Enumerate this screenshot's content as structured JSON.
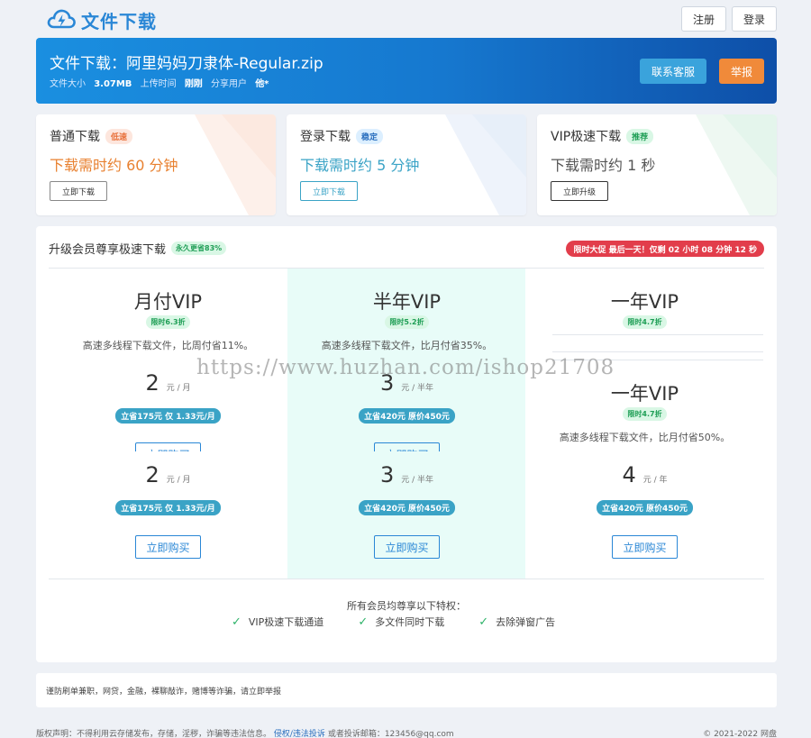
{
  "header": {
    "logo_text": "文件下载",
    "register": "注册",
    "login": "登录"
  },
  "banner": {
    "title": "文件下载：阿里妈妈刀隶体-Regular.zip",
    "size_label": "文件大小",
    "size_value": "3.07MB",
    "upload_label": "上传时间",
    "upload_value": "刚刚",
    "share_label": "分享用户",
    "share_value": "他*",
    "contact": "联系客服",
    "report": "举报"
  },
  "download_cards": [
    {
      "name": "普通下载",
      "tag": "低速",
      "time": "下载需时约 60 分钟",
      "button": "立即下载",
      "tag_bg": "#fde6dd",
      "tag_color": "#e8703a",
      "time_color": "#e8802f",
      "btn_border": "#888888",
      "btn_color": "#333333"
    },
    {
      "name": "登录下载",
      "tag": "稳定",
      "time": "下载需时约 5 分钟",
      "button": "立即下载",
      "tag_bg": "#dcefff",
      "tag_color": "#2a6fbe",
      "time_color": "#3aa3c6",
      "btn_border": "#3aa3c6",
      "btn_color": "#3aa3c6"
    },
    {
      "name": "VIP极速下载",
      "tag": "推荐",
      "time": "下载需时约 1 秒",
      "button": "立即升级",
      "tag_bg": "#d9f7e5",
      "tag_color": "#1e9e55",
      "time_color": "#555555",
      "btn_border": "#333333",
      "btn_color": "#333333"
    }
  ],
  "vip": {
    "heading": "升级会员尊享极速下载",
    "heading_badge": "永久更省83%",
    "promo": "限时大促 最后一天！仅剩 02 小时 08 分钟 12 秒",
    "plans": {
      "monthly": {
        "name": "月付VIP",
        "badge": "限时6.3折",
        "desc": "高速多线程下载文件，比周付省11%。",
        "price": "2",
        "unit": "元 / 月",
        "save": "立省175元 仅 1.33元/月",
        "buy": "立即购买"
      },
      "halfyear": {
        "name": "半年VIP",
        "badge": "限时5.2折",
        "desc": "高速多线程下载文件，比月付省35%。",
        "price": "3",
        "unit": "元 / 半年",
        "save": "立省420元 原价450元",
        "buy": "立即购买"
      },
      "yearly": {
        "name": "一年VIP",
        "badge": "限时4.7折",
        "desc": "高速多线程下载文件，比月付省50%。",
        "price": "4",
        "unit": "元 / 年",
        "save": "立省420元 原价450元",
        "buy": "立即购买"
      }
    },
    "perk_title": "所有会员均尊享以下特权：",
    "perks": [
      "VIP极速下载通道",
      "多文件同时下载",
      "去除弹窗广告"
    ]
  },
  "notice": "谨防刷单兼职，网贷，金融，裸聊敲诈，赌博等诈骗，请立即举报",
  "footer": {
    "left_pre": "版权声明：不得利用云存储发布，存储，淫秽，诈骗等违法信息。",
    "left_link": "侵权/违法投诉",
    "left_post": "或者投诉邮箱：123456@qq.com",
    "right": "© 2021-2022 网盘"
  },
  "watermark": "https://www.huzhan.com/ishop21708"
}
